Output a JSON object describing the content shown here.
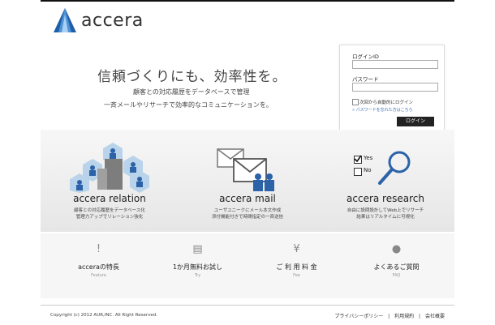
{
  "brand": {
    "name": "accera"
  },
  "hero": {
    "title": "信頼づくりにも、効率性を。",
    "line1": "顧客との対応履歴をデータベースで管理",
    "line2": "一斉メールやリサーチで効率的なコミュニケーションを。"
  },
  "login": {
    "id_label": "ログインID",
    "password_label": "パスワード",
    "remember_label": "次回から自動的にログイン",
    "forgot_link": "» パスワードを忘れた方はこちら",
    "submit_label": "ログイン"
  },
  "features": [
    {
      "name": "accera relation",
      "desc1": "顧客との対応履歴をデータベース化",
      "desc2": "管理力アップでリレーション強化"
    },
    {
      "name": "accera mail",
      "desc1": "ユーザユニークにメール本文作成",
      "desc2": "添付機能付きで時間指定の一斉送信"
    },
    {
      "name": "accera research",
      "desc1": "自由に設問設計してWeb上でリサーチ",
      "desc2": "結果はリアルタイムに可視化",
      "yes": "Yes",
      "no": "No"
    }
  ],
  "nav": [
    {
      "title": "acceraの特長",
      "sub": "Feature",
      "icon": "exclamation-icon",
      "glyph": "!"
    },
    {
      "title": "1か月無料お試し",
      "sub": "Try",
      "icon": "document-icon",
      "glyph": "▤"
    },
    {
      "title": "ご 利 用 料 金",
      "sub": "Fee",
      "icon": "yen-icon",
      "glyph": "¥"
    },
    {
      "title": "よくあるご質問",
      "sub": "FAQ",
      "icon": "speech-bubble-icon",
      "glyph": "●"
    }
  ],
  "footer": {
    "copyright": "Copyright (c) 2012 AUR,INC. All Right Reserved.",
    "links": [
      "プライバシーポリシー",
      "利用規約",
      "会社概要"
    ],
    "separator": "|"
  },
  "colors": {
    "accent_blue": "#2b62a8",
    "button_dark": "#222222",
    "link_blue": "#3a6eb5"
  }
}
